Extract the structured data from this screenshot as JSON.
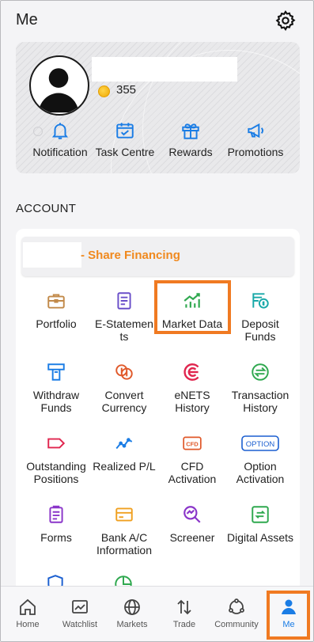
{
  "header": {
    "title": "Me"
  },
  "profile": {
    "points": "355",
    "shortcuts": [
      {
        "label": "Notification",
        "icon": "bell-icon"
      },
      {
        "label": "Task Centre",
        "icon": "calendar-check-icon"
      },
      {
        "label": "Rewards",
        "icon": "gift-icon"
      },
      {
        "label": "Promotions",
        "icon": "megaphone-icon"
      }
    ]
  },
  "account": {
    "section_title": "ACCOUNT",
    "banner": "- Share Financing",
    "items": [
      {
        "label": "Portfolio",
        "icon": "briefcase-icon"
      },
      {
        "label": "E-Statemen ts",
        "icon": "document-icon"
      },
      {
        "label": "Market Data",
        "icon": "chart-icon"
      },
      {
        "label": "Deposit Funds",
        "icon": "deposit-icon"
      },
      {
        "label": "Withdraw Funds",
        "icon": "withdraw-icon"
      },
      {
        "label": "Convert Currency",
        "icon": "currency-icon"
      },
      {
        "label": "eNETS History",
        "icon": "enets-icon"
      },
      {
        "label": "Transaction History",
        "icon": "transfer-icon"
      },
      {
        "label": "Outstanding Positions",
        "icon": "tag-icon"
      },
      {
        "label": "Realized P/L",
        "icon": "trend-line-icon"
      },
      {
        "label": "CFD Activation",
        "icon": "cfd-icon"
      },
      {
        "label": "Option Activation",
        "icon": "option-icon"
      },
      {
        "label": "Forms",
        "icon": "clipboard-icon"
      },
      {
        "label": "Bank A/C Information",
        "icon": "card-icon"
      },
      {
        "label": "Screener",
        "icon": "screener-icon"
      },
      {
        "label": "Digital Assets",
        "icon": "digital-assets-icon"
      }
    ]
  },
  "nav": [
    {
      "label": "Home",
      "icon": "home-icon"
    },
    {
      "label": "Watchlist",
      "icon": "watchlist-icon"
    },
    {
      "label": "Markets",
      "icon": "globe-icon"
    },
    {
      "label": "Trade",
      "icon": "trade-arrows-icon"
    },
    {
      "label": "Community",
      "icon": "community-icon"
    },
    {
      "label": "Me",
      "icon": "person-icon"
    }
  ],
  "colors": {
    "accent_orange": "#f07a22",
    "banner_text": "#f0891e",
    "active_blue": "#1b7de5"
  }
}
